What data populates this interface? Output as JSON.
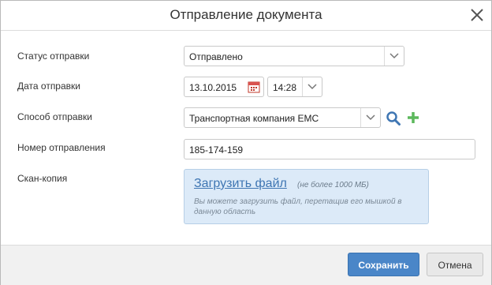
{
  "dialog": {
    "title": "Отправление документа"
  },
  "form": {
    "status": {
      "label": "Статус отправки",
      "value": "Отправлено"
    },
    "date": {
      "label": "Дата отправки",
      "date_value": "13.10.2015",
      "time_value": "14:28"
    },
    "method": {
      "label": "Способ отправки",
      "value": "Транспортная компания EMC"
    },
    "tracking": {
      "label": "Номер отправления",
      "value": "185-174-159"
    },
    "scan": {
      "label": "Скан-копия",
      "upload_link": "Загрузить файл",
      "limit": "(не более 1000 МБ)",
      "hint": "Вы можете загрузить файл, перетащив его мышкой в данную область"
    }
  },
  "footer": {
    "save_label": "Сохранить",
    "cancel_label": "Отмена"
  },
  "colors": {
    "primary": "#4a86c8",
    "upload_bg": "#dceaf8",
    "add_icon": "#5cb85c",
    "search_icon": "#3f76b3"
  }
}
